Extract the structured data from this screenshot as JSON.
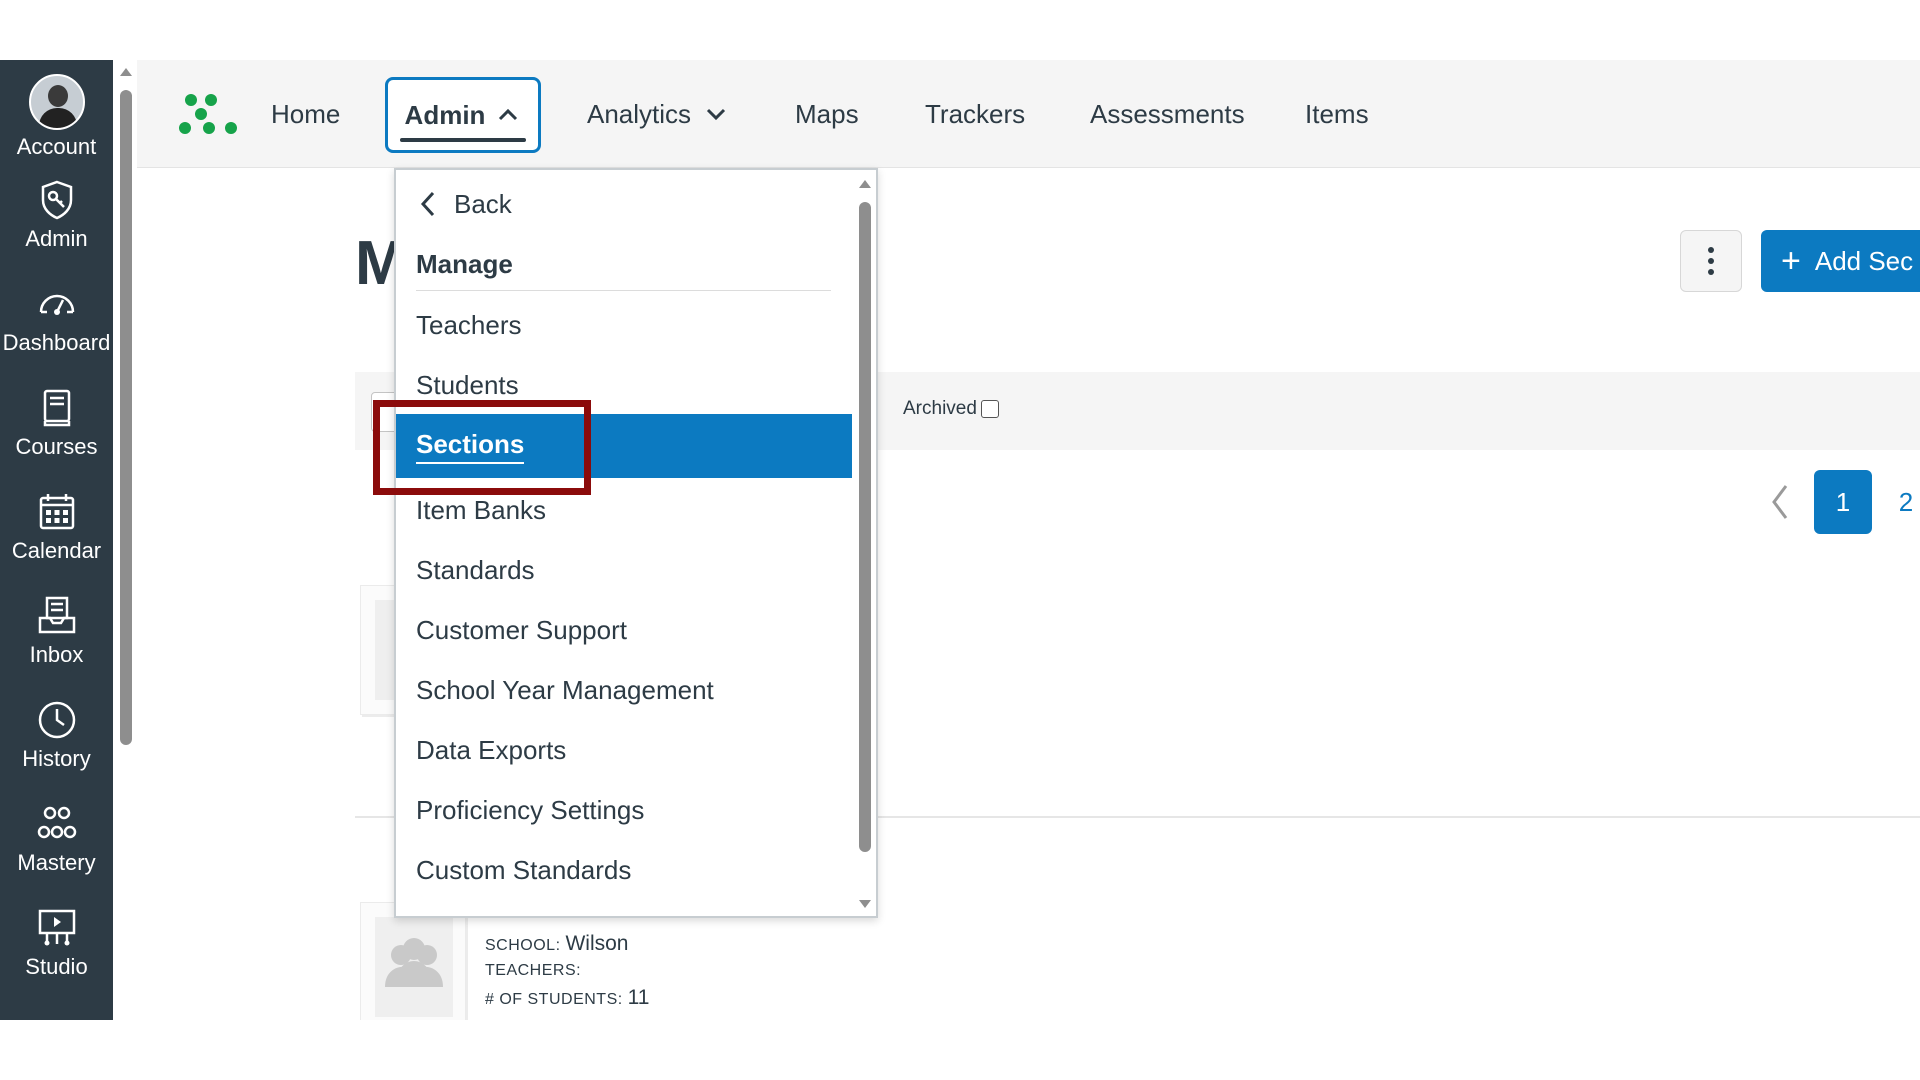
{
  "global_nav": {
    "account": "Account",
    "admin": "Admin",
    "dashboard": "Dashboard",
    "courses": "Courses",
    "calendar": "Calendar",
    "inbox": "Inbox",
    "history": "History",
    "mastery": "Mastery",
    "studio": "Studio"
  },
  "topbar": {
    "home": "Home",
    "admin": "Admin",
    "analytics": "Analytics",
    "maps": "Maps",
    "trackers": "Trackers",
    "assessments": "Assessments",
    "items": "Items"
  },
  "main": {
    "heading_partial": "M",
    "add_button": "Add Sec",
    "archived_label": "Archived",
    "archived_checked": false,
    "pagination": {
      "current": "1",
      "next": "2"
    },
    "card": {
      "school_label": "SCHOOL:",
      "school_value": "Wilson",
      "teachers_label": "TEACHERS:",
      "students_label": "# OF STUDENTS:",
      "students_value": "11"
    }
  },
  "dropdown": {
    "back": "Back",
    "heading": "Manage",
    "items": [
      "Teachers",
      "Students",
      "Sections",
      "Item Banks",
      "Standards",
      "Customer Support",
      "School Year Management",
      "Data Exports",
      "Proficiency Settings",
      "Custom Standards"
    ],
    "active_item": "Sections"
  },
  "colors": {
    "nav_bg": "#2d3b45",
    "accent": "#0c7ac1",
    "highlight_box": "#8b0b0b",
    "logo_green": "#16a34a"
  }
}
